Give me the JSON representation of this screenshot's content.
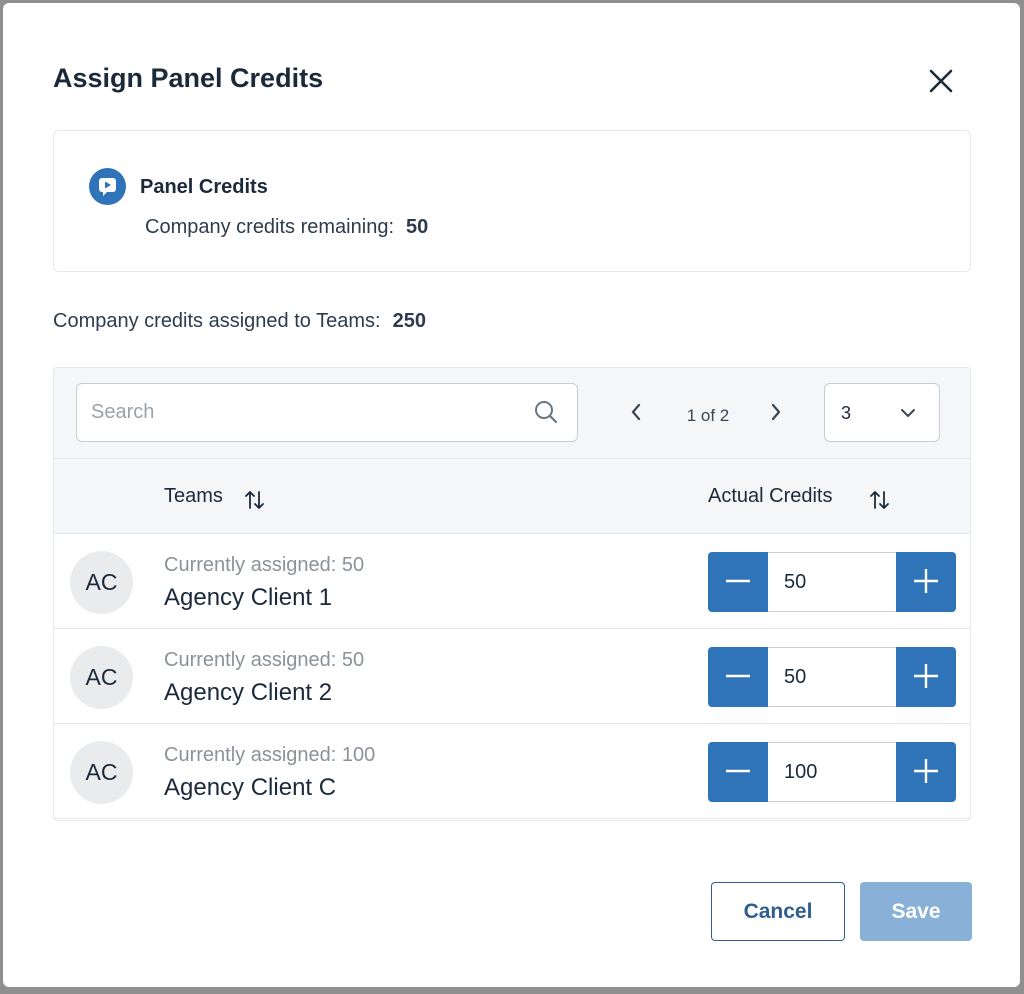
{
  "modal": {
    "title": "Assign Panel Credits"
  },
  "info_card": {
    "heading": "Panel Credits",
    "remaining_label": "Company credits remaining:",
    "remaining_value": "50"
  },
  "assigned": {
    "label": "Company credits assigned to Teams:",
    "value": "250"
  },
  "toolbar": {
    "search_placeholder": "Search",
    "search_value": "",
    "pagination_label": "1 of 2",
    "page_size": "3"
  },
  "table": {
    "columns": {
      "teams": "Teams",
      "credits": "Actual Credits"
    },
    "rows": [
      {
        "initials": "AC",
        "subtitle": "Currently assigned: 50",
        "name": "Agency Client 1",
        "credits": "50"
      },
      {
        "initials": "AC",
        "subtitle": "Currently assigned: 50",
        "name": "Agency Client 2",
        "credits": "50"
      },
      {
        "initials": "AC",
        "subtitle": "Currently assigned: 100",
        "name": "Agency Client C",
        "credits": "100"
      }
    ]
  },
  "footer": {
    "cancel_label": "Cancel",
    "save_label": "Save"
  },
  "colors": {
    "primary": "#2f74b8",
    "save_disabled": "#89b0d6",
    "cancel_border": "#2f5f8f"
  },
  "icons": [
    "close-icon",
    "panel-credits-icon",
    "search-icon",
    "chevron-left-icon",
    "chevron-right-icon",
    "chevron-down-icon",
    "sort-icon",
    "minus-icon",
    "plus-icon"
  ]
}
